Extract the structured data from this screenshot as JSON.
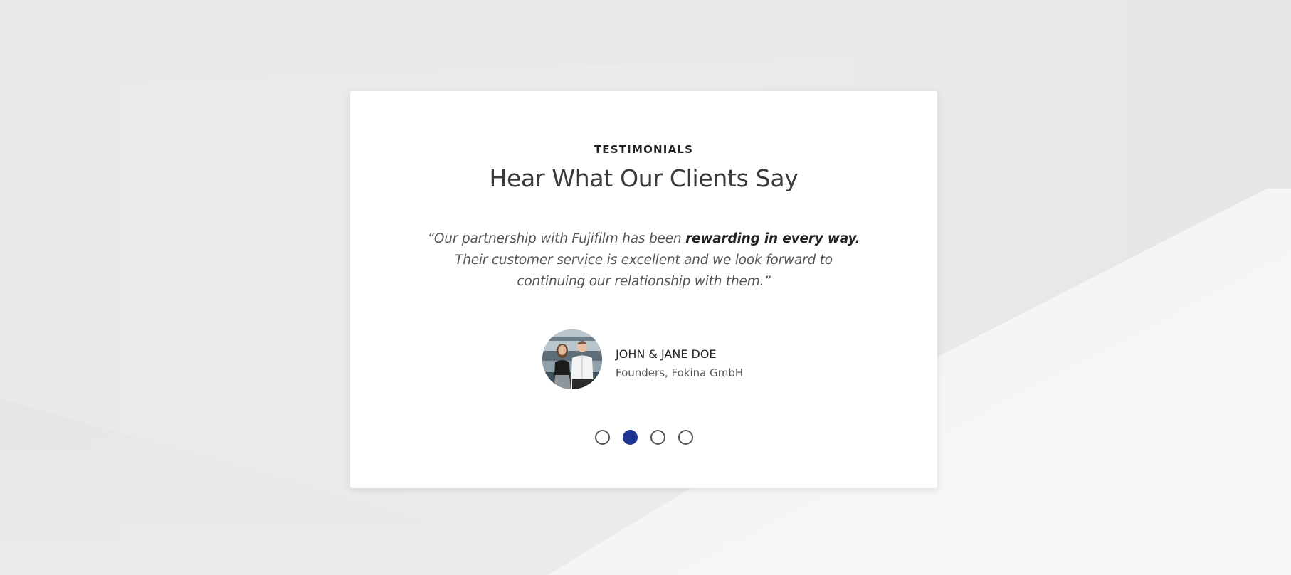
{
  "section": {
    "eyebrow": "TESTIMONIALS",
    "heading": "Hear What Our Clients Say"
  },
  "testimonial": {
    "quote_before": "“Our partnership with Fujifilm has been ",
    "quote_bold": "rewarding in every way.",
    "quote_after": " Their customer service is excellent and we look forward to continuing our relationship with them.”",
    "author_name": "JOHN & JANE DOE",
    "author_role": "Founders, Fokina GmbH"
  },
  "carousel": {
    "total_slides": 4,
    "active_slide": 2
  },
  "colors": {
    "accent": "#1e3593",
    "card": "#ffffff",
    "background": "#e8e8e8"
  }
}
